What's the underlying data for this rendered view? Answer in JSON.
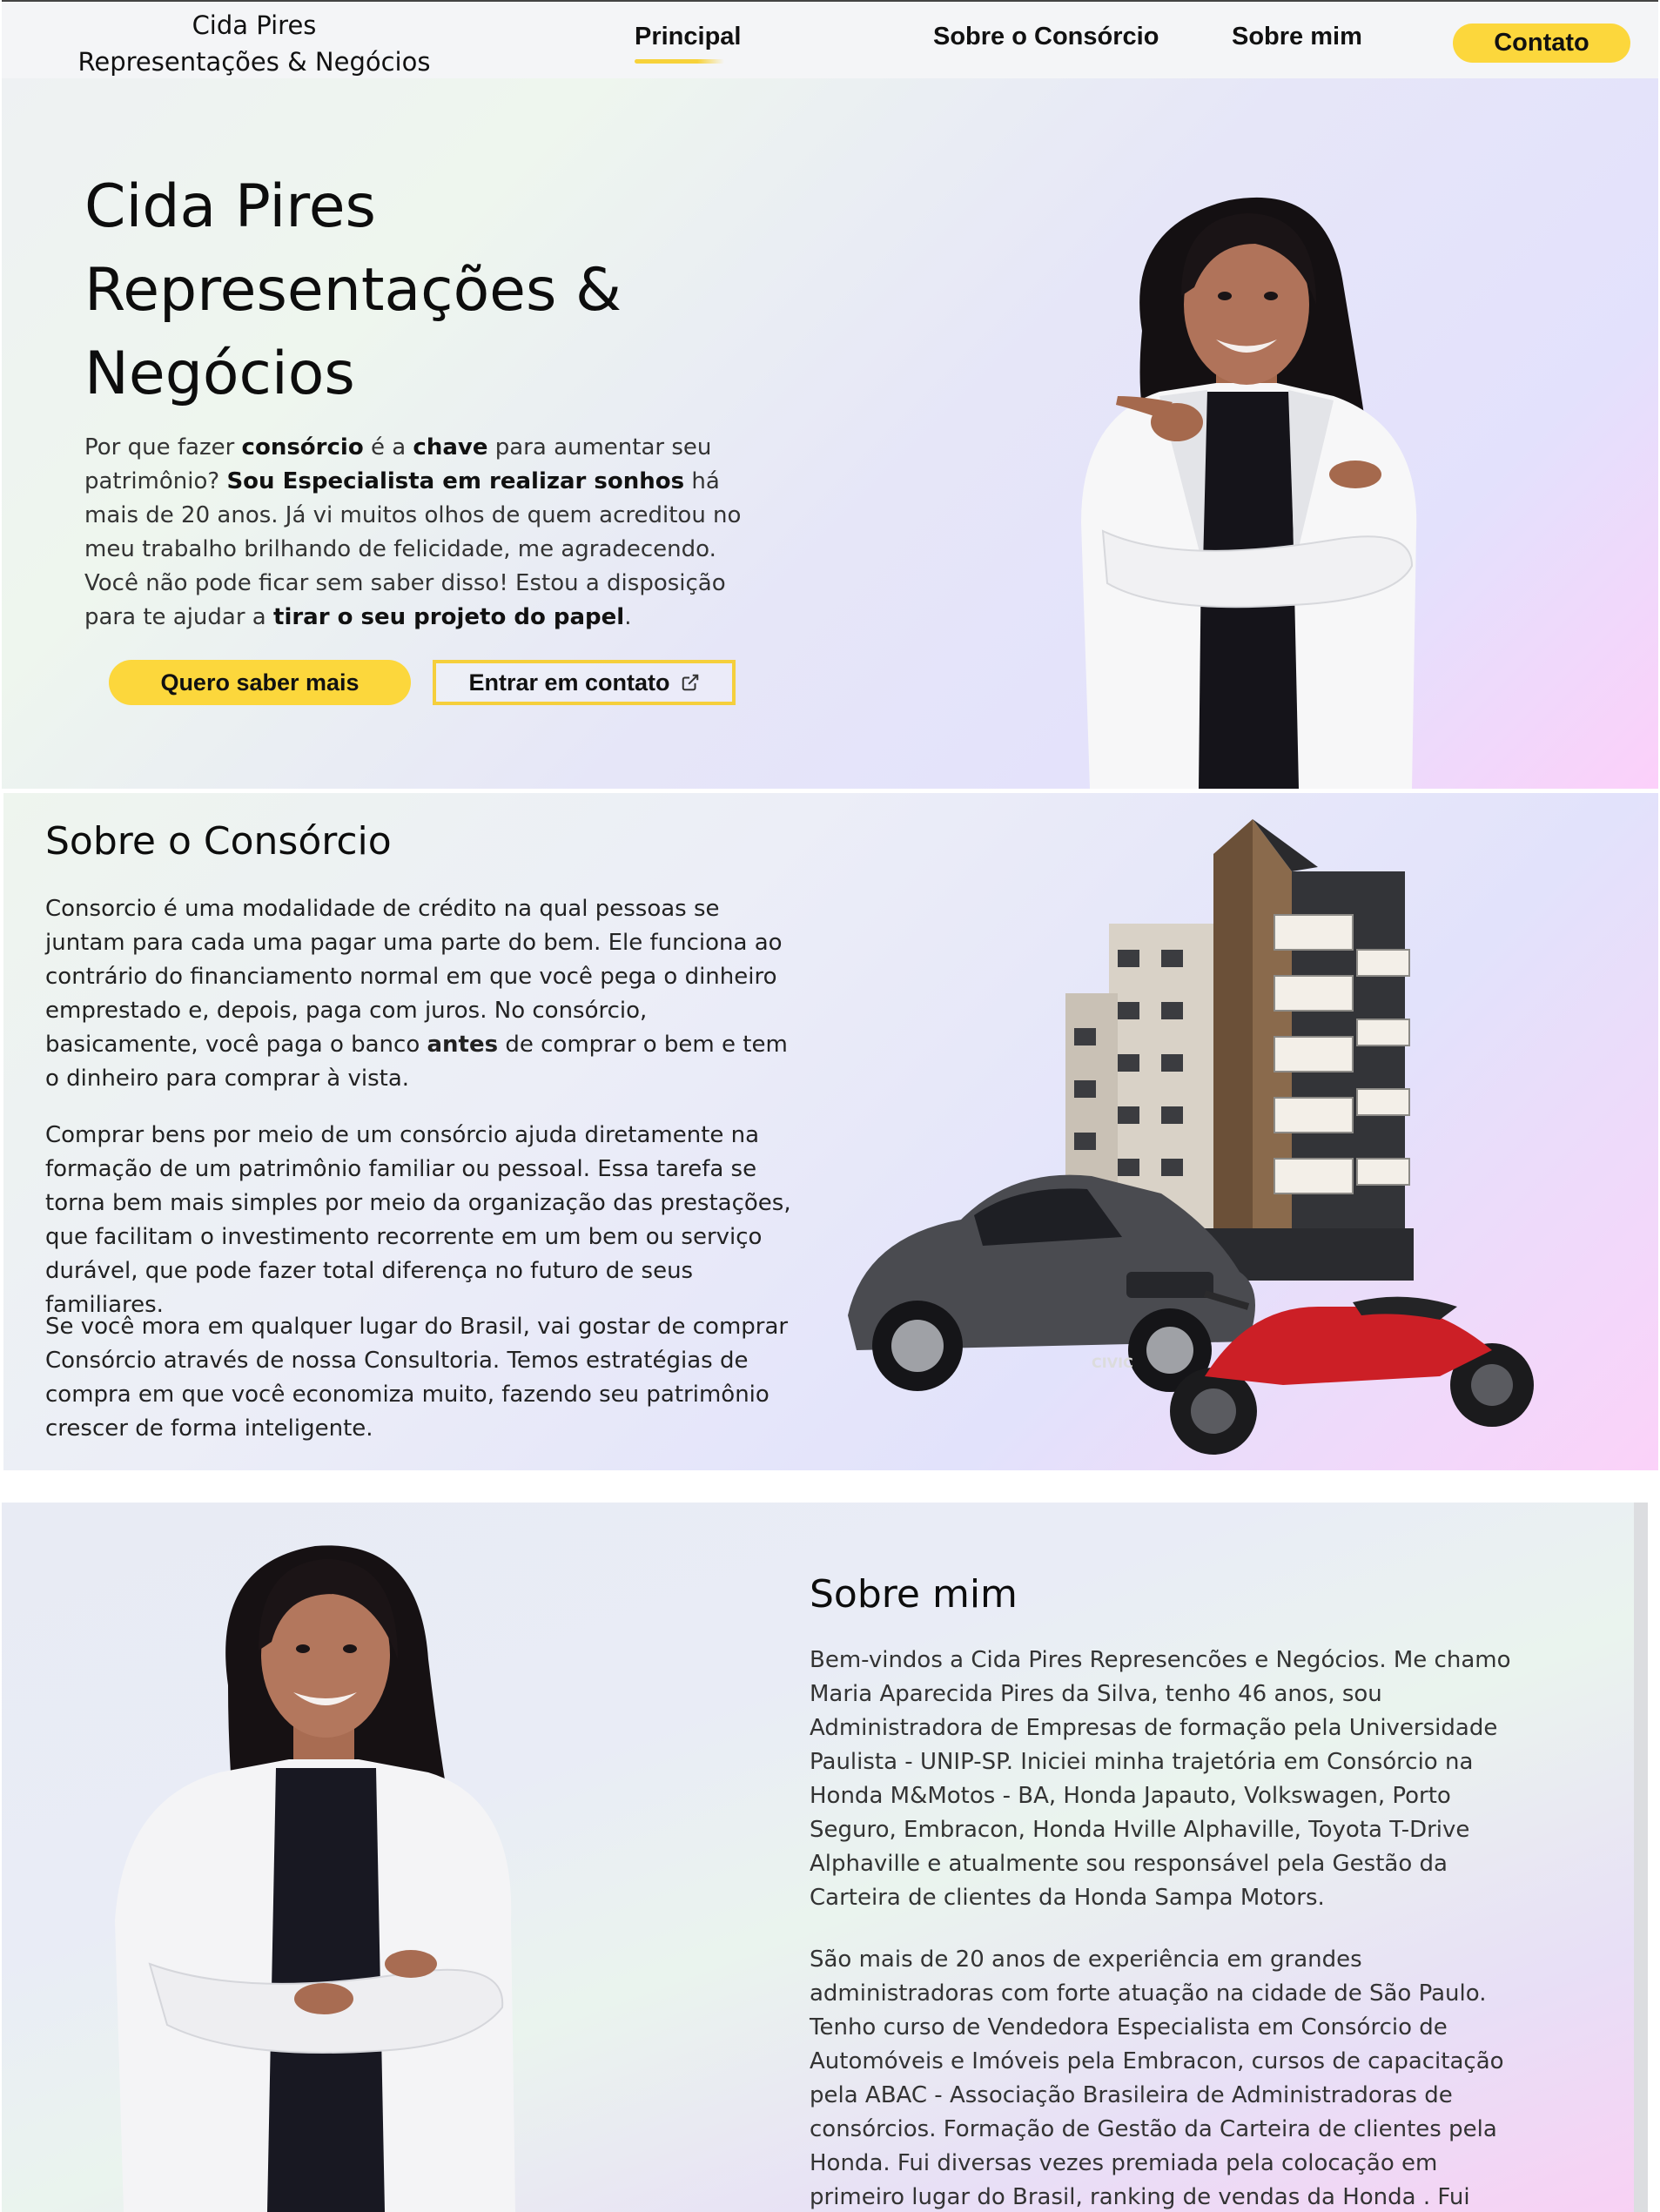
{
  "nav": {
    "brand_line1": "Cida Pires",
    "brand_line2": "Representações & Negócios",
    "links": [
      "Principal",
      "Sobre o Consórcio",
      "Sobre mim"
    ],
    "contact_button": "Contato",
    "active": "Principal"
  },
  "hero": {
    "title_line1": "Cida Pires",
    "title_line2": "Representações &",
    "title_line3": "Negócios",
    "text": {
      "t1": "Por que fazer ",
      "b1": "consórcio",
      "t2": " é a ",
      "b2": "chave",
      "t3": " para aumentar seu patrimônio? ",
      "b3": "Sou Especialista em realizar sonhos",
      "t4": " há mais de 20 anos. Já vi muitos olhos de quem acreditou no meu trabalho brilhando de felicidade, me agradecendo. Você não pode ficar sem saber disso! Estou a disposição para te ajudar a ",
      "b4": "tirar o seu projeto do papel",
      "t5": "."
    },
    "primary_button": "Quero saber mais",
    "secondary_button": "Entrar em contato",
    "secondary_icon": "external-link-icon"
  },
  "consorcio": {
    "title": "Sobre o Consórcio",
    "p1_a": "Consorcio é uma modalidade de crédito na qual pessoas se juntam para cada uma pagar uma parte do bem. Ele funciona ao contrário do financiamento normal em que você pega o dinheiro emprestado e, depois, paga com juros. No consórcio, basicamente, você paga o banco ",
    "p1_b": "antes",
    "p1_c": " de comprar o bem e tem o dinheiro para comprar à vista.",
    "p2": "Comprar bens por meio de um consórcio ajuda diretamente na formação de um patrimônio familiar ou pessoal. Essa tarefa se torna bem mais simples por meio da organização das prestações, que facilitam o investimento recorrente em um bem ou serviço durável, que pode fazer total diferença no futuro de seus familiares.",
    "p3": "Se você mora em qualquer lugar do Brasil, vai gostar de comprar Consórcio através de nossa Consultoria. Temos estratégias de compra em que você economiza muito, fazendo seu patrimônio crescer de forma inteligente.",
    "car_badge": "CIVIC"
  },
  "sobre_mim": {
    "title": "Sobre mim",
    "p1": "Bem-vindos a Cida Pires Represencões e Negócios. Me chamo Maria Aparecida Pires da Silva, tenho 46 anos, sou Administradora de Empresas de formação pela Universidade Paulista - UNIP-SP. Iniciei minha trajetória em Consórcio na Honda M&Motos - BA, Honda Japauto, Volkswagen, Porto Seguro, Embracon, Honda Hville Alphaville, Toyota T-Drive Alphaville e atualmente sou responsável pela Gestão da Carteira de clientes da Honda Sampa Motors.",
    "p2": "São mais de 20 anos de experiência em grandes administradoras com forte atuação na cidade de São Paulo. Tenho curso de Vendedora Especialista em Consórcio de Automóveis e Imóveis pela Embracon, cursos de capacitação pela ABAC - Associação Brasileira de Administradoras de consórcios. Formação de Gestão da Carteira de clientes pela Honda. Fui diversas vezes premiada pela colocação em primeiro lugar do Brasil, ranking de vendas da Honda . Fui"
  },
  "colors": {
    "accent_yellow": "#fcd73c",
    "text_dark": "#111111"
  }
}
